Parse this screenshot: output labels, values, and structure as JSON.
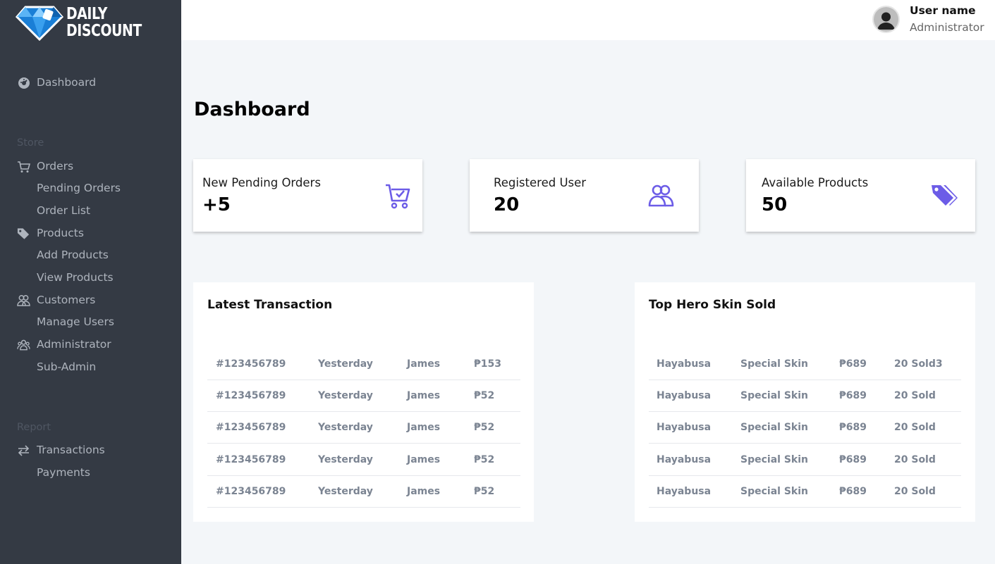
{
  "brand": {
    "line1": "DAILY",
    "line2": "DISCOUNT"
  },
  "user": {
    "name": "User name",
    "role": "Administrator"
  },
  "nav": {
    "dashboard": "Dashboard",
    "store_section": "Store",
    "orders": "Orders",
    "pending_orders": "Pending Orders",
    "order_list": "Order List",
    "products": "Products",
    "add_products": "Add Products",
    "view_products": "View Products",
    "customers": "Customers",
    "manage_users": "Manage Users",
    "administrator": "Administrator",
    "sub_admin": "Sub-Admin",
    "report_section": "Report",
    "transactions": "Transactions",
    "payments": "Payments"
  },
  "page": {
    "title": "Dashboard"
  },
  "stats": [
    {
      "title": "New Pending Orders",
      "value": "+5",
      "icon": "cart-check-icon"
    },
    {
      "title": "Registered User",
      "value": "20",
      "icon": "users-icon"
    },
    {
      "title": "Available Products",
      "value": "50",
      "icon": "tags-icon"
    }
  ],
  "latest_transaction": {
    "title": "Latest Transaction",
    "rows": [
      [
        "#123456789",
        "Yesterday",
        "James",
        "₱153"
      ],
      [
        "#123456789",
        "Yesterday",
        "James",
        "₱52"
      ],
      [
        "#123456789",
        "Yesterday",
        "James",
        "₱52"
      ],
      [
        "#123456789",
        "Yesterday",
        "James",
        "₱52"
      ],
      [
        "#123456789",
        "Yesterday",
        "James",
        "₱52"
      ]
    ]
  },
  "top_skins": {
    "title": "Top Hero Skin Sold",
    "rows": [
      [
        "Hayabusa",
        "Special Skin",
        "₱689",
        "20 Sold3"
      ],
      [
        "Hayabusa",
        "Special Skin",
        "₱689",
        "20 Sold"
      ],
      [
        "Hayabusa",
        "Special Skin",
        "₱689",
        "20 Sold"
      ],
      [
        "Hayabusa",
        "Special Skin",
        "₱689",
        "20 Sold"
      ],
      [
        "Hayabusa",
        "Special Skin",
        "₱689",
        "20 Sold"
      ]
    ]
  },
  "colors": {
    "sidebar": "#343a44",
    "accent": "#6c5ce7",
    "background": "#f3f6f9"
  }
}
